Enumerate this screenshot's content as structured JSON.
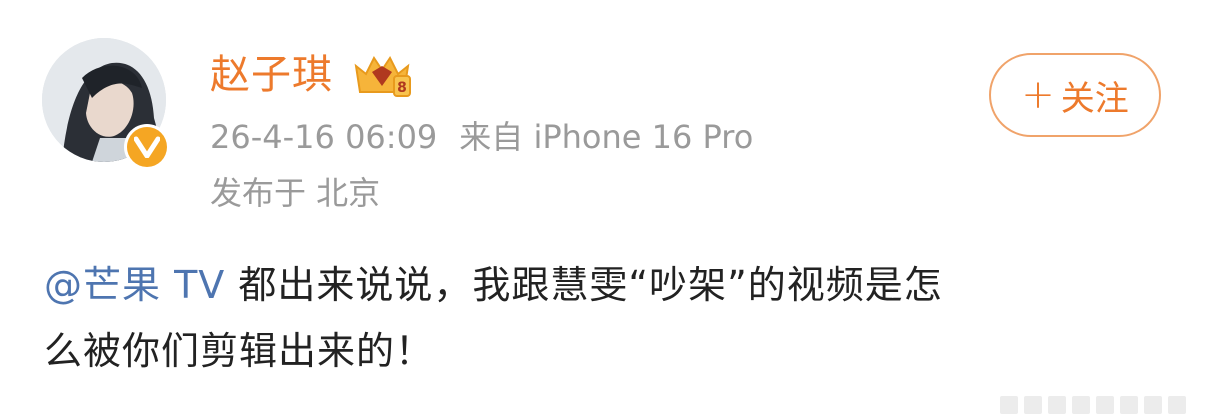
{
  "user": {
    "name": "赵子琪",
    "vip_icon": "vip-crown-badge-icon",
    "verified_icon": "verified-v-icon",
    "verified_label": "V"
  },
  "meta": {
    "time": "26-4-16 06:09",
    "source": "来自 iPhone 16 Pro",
    "location": "发布于 北京"
  },
  "follow": {
    "plus": "+",
    "label": "关注"
  },
  "post": {
    "mention": "@芒果 TV",
    "line1_text": " 都出来说说，我跟慧雯“吵架”的视频是怎",
    "line2_text": "么被你们剪辑出来的！"
  },
  "colors": {
    "name_orange": "#ed7a2c",
    "link_blue": "#4e75b0",
    "meta_gray": "#9a9a9a",
    "text_dark": "#222222",
    "verified_gold": "#f5a623"
  }
}
